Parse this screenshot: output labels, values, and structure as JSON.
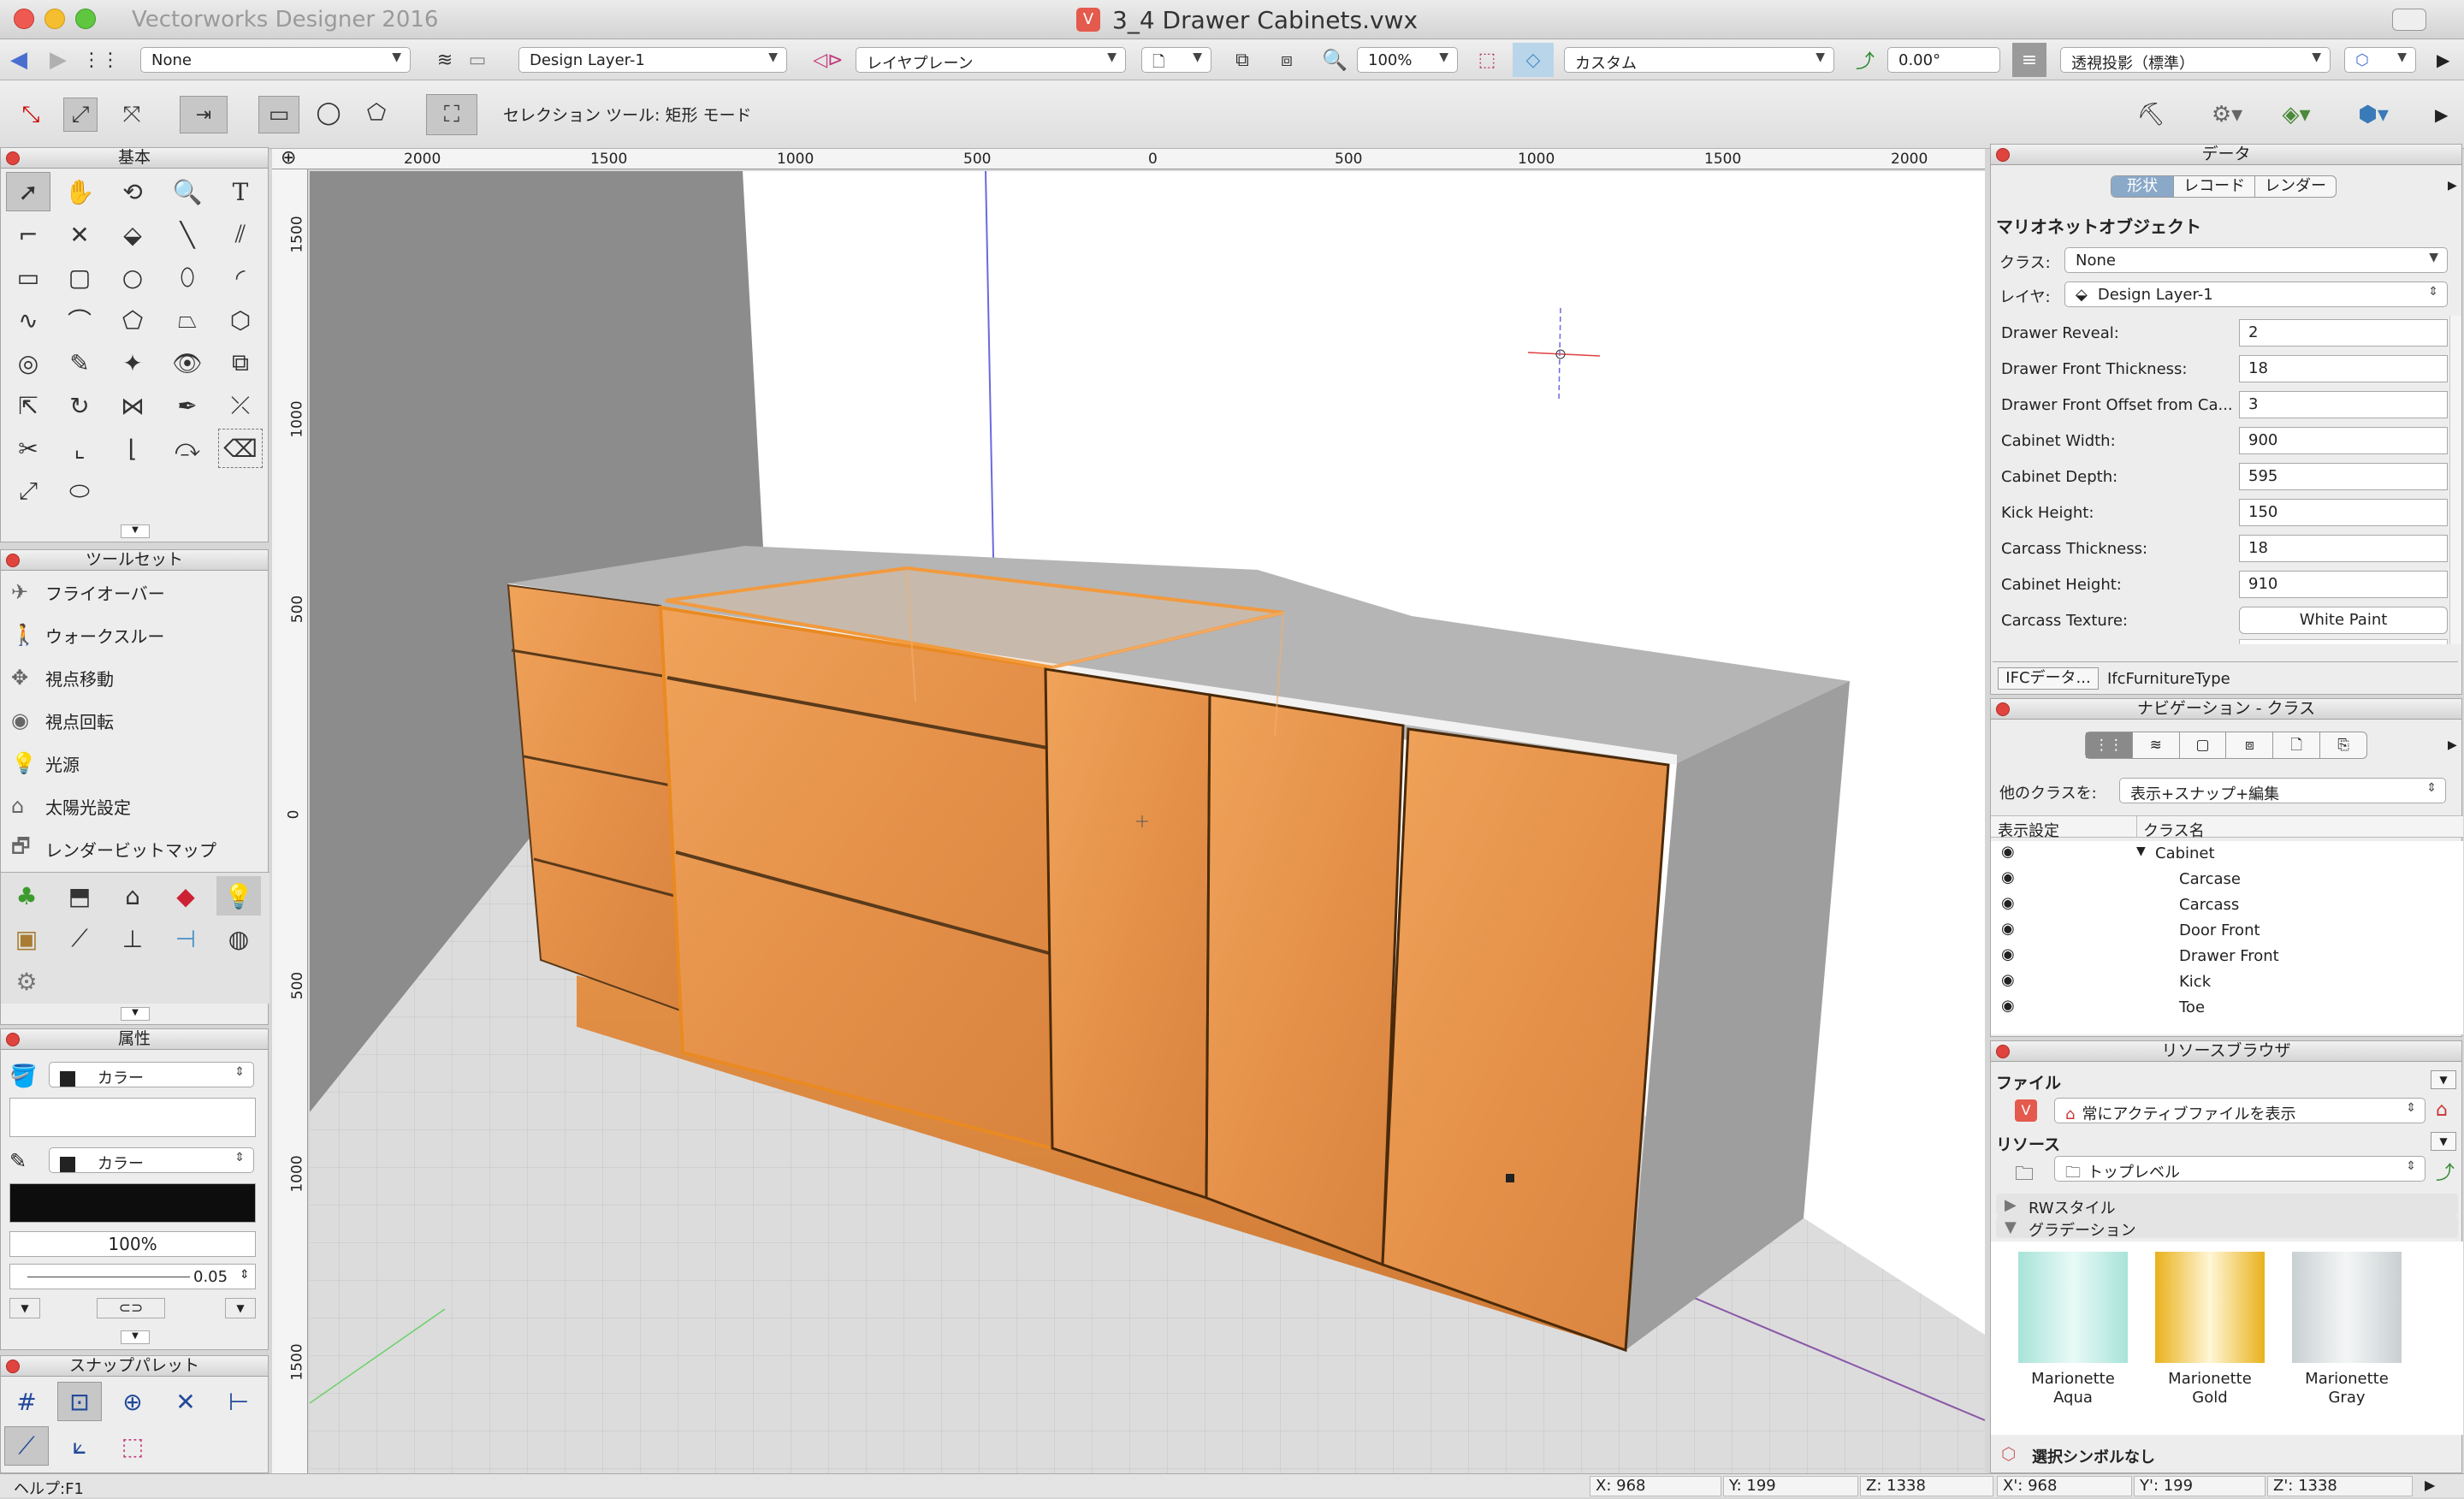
{
  "app_title": "Vectorworks Designer 2016",
  "document_title": "3_4 Drawer Cabinets.vwx",
  "view_bar": {
    "class": "None",
    "layer": "Design Layer-1",
    "plane": "レイヤプレーン",
    "zoom": "100%",
    "render_mode": "カスタム",
    "rotation": "0.00°",
    "projection": "透視投影（標準）"
  },
  "mode_bar": {
    "status": "セレクション ツール: 矩形 モード"
  },
  "rulers": {
    "h": [
      "2000",
      "1500",
      "1000",
      "500",
      "0",
      "500",
      "1000",
      "1500",
      "2000"
    ],
    "v": [
      "1500",
      "1000",
      "500",
      "0",
      "500",
      "1000",
      "1500"
    ]
  },
  "basic_palette": {
    "title": "基本"
  },
  "toolset_palette": {
    "title": "ツールセット",
    "items": [
      {
        "label": "フライオーバー",
        "icon": "flyover-icon"
      },
      {
        "label": "ウォークスルー",
        "icon": "walkthrough-icon"
      },
      {
        "label": "視点移動",
        "icon": "translate-view-icon"
      },
      {
        "label": "視点回転",
        "icon": "rotate-view-icon"
      },
      {
        "label": "光源",
        "icon": "light-icon"
      },
      {
        "label": "太陽光設定",
        "icon": "sun-icon"
      },
      {
        "label": "レンダービットマップ",
        "icon": "render-bitmap-icon"
      }
    ]
  },
  "attributes_palette": {
    "title": "属性",
    "fill_label": "カラー",
    "pen_label": "カラー",
    "opacity": "100%",
    "line_thickness": "0.05"
  },
  "snap_palette": {
    "title": "スナップパレット"
  },
  "status_bar": {
    "help": "ヘルプ:F1",
    "x": "X:  968",
    "y": "Y:  199",
    "z": "Z:  1338",
    "x2": "X':  968",
    "y2": "Y':  199",
    "z2": "Z':  1338"
  },
  "obj_info": {
    "title": "データ",
    "tabs": [
      "形状",
      "レコード",
      "レンダー"
    ],
    "object_type": "マリオネットオブジェクト",
    "class_label": "クラス:",
    "class_value": "None",
    "layer_label": "レイヤ:",
    "layer_value": "Design Layer-1",
    "fields": [
      {
        "label": "Drawer Reveal:",
        "value": "2"
      },
      {
        "label": "Drawer Front Thickness:",
        "value": "18"
      },
      {
        "label": "Drawer Front Offset from Ca...",
        "value": "3"
      },
      {
        "label": "Cabinet Width:",
        "value": "900"
      },
      {
        "label": "Cabinet Depth:",
        "value": "595"
      },
      {
        "label": "Kick Height:",
        "value": "150"
      },
      {
        "label": "Carcass Thickness:",
        "value": "18"
      },
      {
        "label": "Cabinet Height:",
        "value": "910"
      },
      {
        "label": "Carcass Texture:",
        "value": "White Paint"
      }
    ],
    "ifc_button": "IFCデータ...",
    "ifc_type": "IfcFurnitureType"
  },
  "nav_palette": {
    "title": "ナビゲーション - クラス",
    "other_label": "他のクラスを:",
    "other_value": "表示+スナップ+編集",
    "col_visibility": "表示設定",
    "col_class": "クラス名",
    "parent": "Cabinet",
    "classes": [
      "Carcase",
      "Carcass",
      "Door Front",
      "Drawer Front",
      "Kick",
      "Toe"
    ]
  },
  "resource_browser": {
    "title": "リソースブラウザ",
    "file_label": "ファイル",
    "file_value": "常にアクティブファイルを表示",
    "resource_label": "リソース",
    "resource_value": "トップレベル",
    "folders": [
      "RWスタイル",
      "グラデーション"
    ],
    "items": [
      {
        "name": "Marionette Aqua",
        "color1": "#a8e3d9",
        "color2": "#e8faf6"
      },
      {
        "name": "Marionette Gold",
        "color1": "#e9b21c",
        "color2": "#fff6d6"
      },
      {
        "name": "Marionette Gray",
        "color1": "#c9d0d2",
        "color2": "#f4f6f6"
      }
    ],
    "footer": "選択シンボルなし"
  }
}
